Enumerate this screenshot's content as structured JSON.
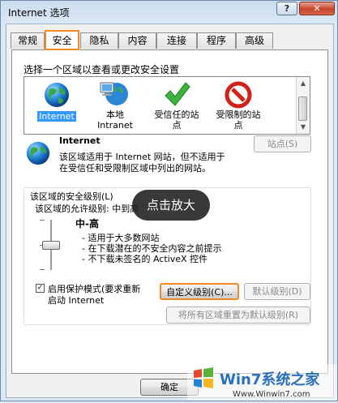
{
  "window": {
    "title": "Internet 选项",
    "help_label": "?",
    "close_label": "✕"
  },
  "tabs": [
    "常规",
    "安全",
    "隐私",
    "内容",
    "连接",
    "程序",
    "高级"
  ],
  "active_tab": "安全",
  "zone_prompt": "选择一个区域以查看或更改安全设置",
  "zones": [
    {
      "label": "Internet",
      "icon": "globe-icon"
    },
    {
      "label": "本地\nIntranet",
      "icon": "local-intranet-icon"
    },
    {
      "label": "受信任的站\n点",
      "icon": "trusted-sites-checkmark-icon"
    },
    {
      "label": "受限制的站\n点",
      "icon": "restricted-sites-no-icon"
    }
  ],
  "selected_zone": {
    "name": "Internet",
    "description_line1": "该区域适用于 Internet 网站，但不适用于",
    "description_line2": "在受信任和受限制区域中列出的网站。",
    "sites_button": "站点(S)"
  },
  "security": {
    "group_label": "该区域的安全级别(L)",
    "allowed_levels": "该区域的允许级别: 中到高",
    "level_name": "中-高",
    "bullets": [
      "- 适用于大多数网站",
      "- 在下载潜在的不安全内容之前提示",
      "- 不下载未签名的 ActiveX 控件"
    ],
    "protected_mode_line1": "启用保护模式(要求重新",
    "protected_mode_line2": "启动 Internet",
    "protected_mode_checked": true,
    "custom_level_button": "自定义级别(C)...",
    "default_level_button": "默认级别(D)",
    "reset_all_button": "将所有区域重置为默认级别(R)"
  },
  "zoom_hint": "点击放大",
  "footer": {
    "ok_button": "确定"
  },
  "watermark": {
    "brand": "Win7系统之家",
    "url": "Www.Winwin7.com"
  },
  "colors": {
    "highlight": "#f08a24",
    "selection": "#3399ff"
  }
}
